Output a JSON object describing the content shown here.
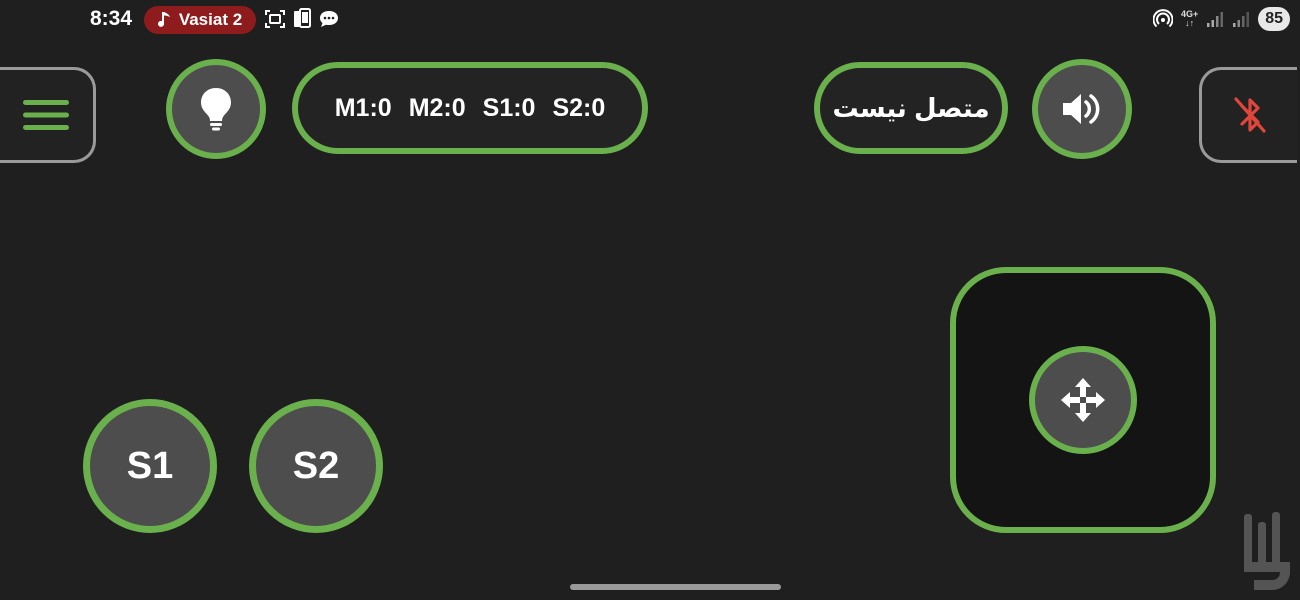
{
  "status_bar": {
    "time": "8:34",
    "music_label": "Vasiat 2",
    "network_label": "4G+",
    "battery": "85",
    "icons_left": [
      "music-note-icon",
      "screenshot-icon",
      "phone-copy-icon",
      "chat-icon"
    ],
    "icons_right": [
      "hotspot-icon",
      "signal-icon",
      "battery-icon"
    ]
  },
  "toolbar": {
    "menu_icon": "hamburger-menu-icon",
    "light_icon": "lightbulb-icon",
    "counters": [
      "M1:0",
      "M2:0",
      "S1:0",
      "S2:0"
    ],
    "connection_status": "متصل نیست",
    "sound_icon": "speaker-icon",
    "bluetooth_icon": "bluetooth-disabled-icon"
  },
  "controls": {
    "s1_label": "S1",
    "s2_label": "S2",
    "joystick_icon": "move-arrows-icon"
  },
  "colors": {
    "accent": "#6ab04c",
    "background": "#1f1f1f",
    "button_fill": "#4d4d4d",
    "bluetooth_off": "#e0463a",
    "music_pill": "#8e1c1c"
  }
}
